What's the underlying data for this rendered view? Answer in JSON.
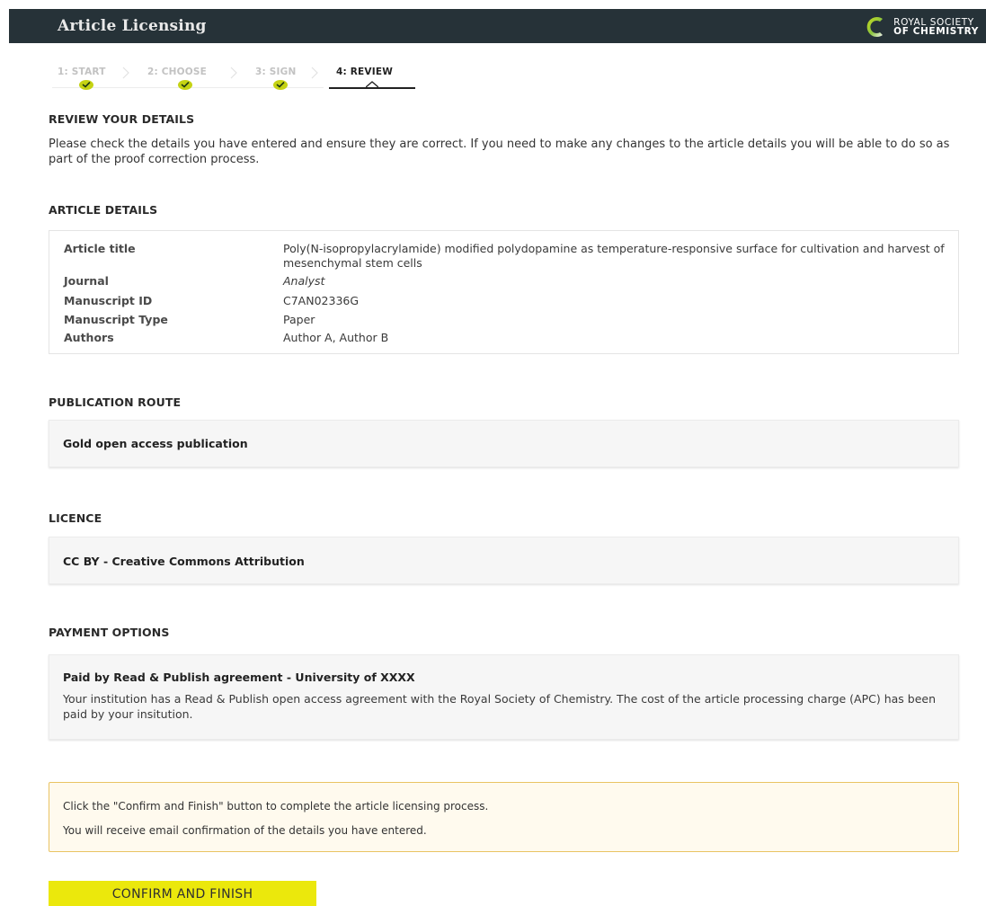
{
  "header": {
    "title": "Article Licensing",
    "logo_line1": "ROYAL SOCIETY",
    "logo_line2": "OF CHEMISTRY"
  },
  "steps": [
    {
      "label": "1: START",
      "state": "done"
    },
    {
      "label": "2: CHOOSE",
      "state": "done"
    },
    {
      "label": "3: SIGN",
      "state": "done"
    },
    {
      "label": "4: REVIEW",
      "state": "current"
    }
  ],
  "review": {
    "heading": "REVIEW YOUR DETAILS",
    "text": "Please check the details you have entered and ensure they are correct. If you need to make any changes to the article details you will be able to do so as part of the proof correction process."
  },
  "article_details": {
    "heading": "ARTICLE DETAILS",
    "rows": [
      {
        "key": "Article title",
        "value": "Poly(N-isopropylacrylamide) modified polydopamine as temperature-responsive surface for cultivation and harvest of mesenchymal stem cells"
      },
      {
        "key": "Journal",
        "value": "Analyst"
      },
      {
        "key": "Manuscript ID",
        "value": "C7AN02336G"
      },
      {
        "key": "Manuscript Type",
        "value": "Paper"
      },
      {
        "key": "Authors",
        "value": "Author A, Author B"
      }
    ]
  },
  "publication_route": {
    "heading": "PUBLICATION ROUTE",
    "value": "Gold open access publication"
  },
  "licence": {
    "heading": "LICENCE",
    "value": "CC BY - Creative Commons Attribution"
  },
  "payment": {
    "heading": "PAYMENT OPTIONS",
    "title": "Paid by Read & Publish agreement - University of XXXX",
    "text": "Your institution has a Read & Publish open access agreement with the Royal Society of Chemistry. The cost of the article processing charge (APC) has been paid by your insitution."
  },
  "notice": {
    "line1": "Click the \"Confirm and Finish\" button to complete the article licensing process.",
    "line2": "You will receive email confirmation of the details you have entered."
  },
  "confirm_label": "CONFIRM AND FINISH",
  "colors": {
    "topbar": "#263238",
    "accent_yellow": "#ebe80c",
    "check_green": "#c5d313",
    "notice_border": "#e9c463"
  }
}
